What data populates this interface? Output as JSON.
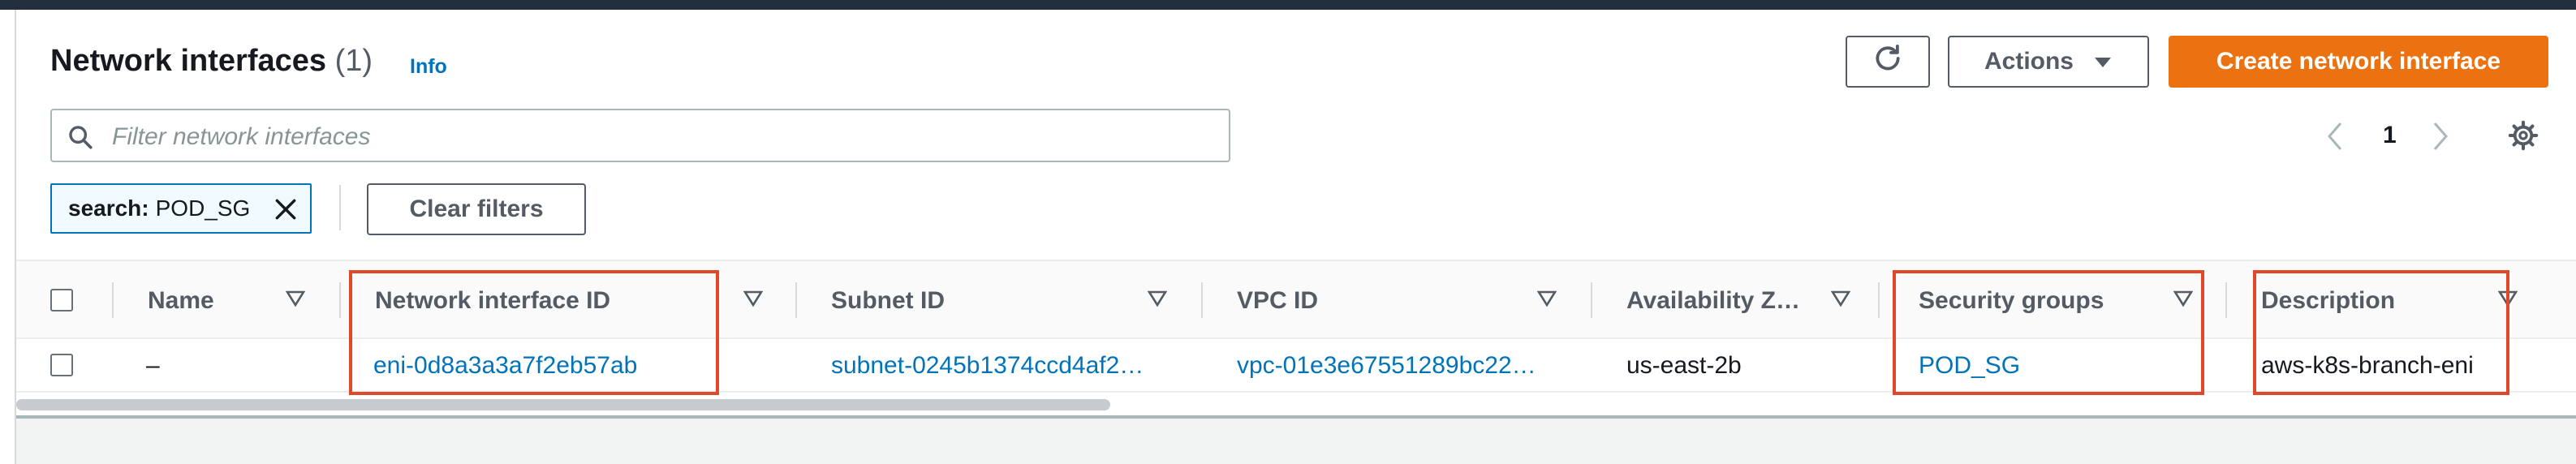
{
  "header": {
    "title": "Network interfaces",
    "count": "(1)",
    "info_label": "Info",
    "actions_label": "Actions",
    "create_label": "Create network interface",
    "refresh_icon": "refresh-icon"
  },
  "filter": {
    "placeholder": "Filter network interfaces",
    "value": "",
    "token_key": "search:",
    "token_value": "POD_SG",
    "clear_label": "Clear filters"
  },
  "pagination": {
    "current_page": "1"
  },
  "table": {
    "columns": [
      "Name",
      "Network interface ID",
      "Subnet ID",
      "VPC ID",
      "Availability Z…",
      "Security groups",
      "Description"
    ],
    "rows": [
      {
        "name": "–",
        "network_interface_id": "eni-0d8a3a3a7f2eb57ab",
        "subnet_id": "subnet-0245b1374ccd4af2…",
        "vpc_id": "vpc-01e3e67551289bc22…",
        "availability_zone": "us-east-2b",
        "security_groups": "POD_SG",
        "description": "aws-k8s-branch-eni"
      }
    ]
  },
  "colors": {
    "accent": "#ec7211",
    "link": "#0073bb",
    "highlight": "#e0482a",
    "topbar": "#232f3e"
  }
}
